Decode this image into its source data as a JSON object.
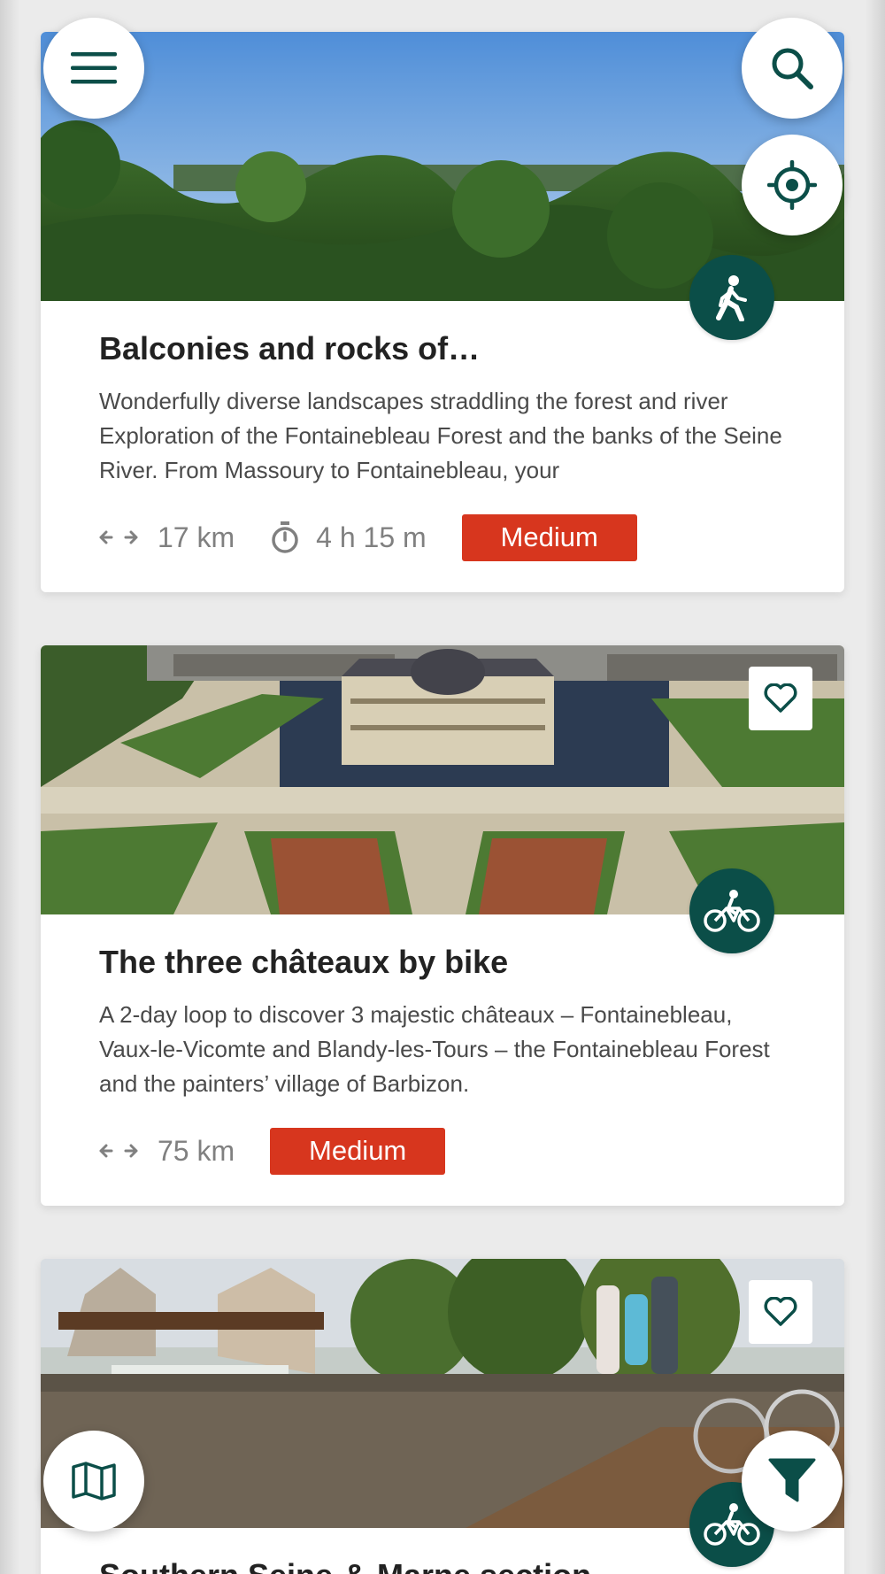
{
  "trails": [
    {
      "title": "Balconies and rocks of…",
      "description": "Wonderfully diverse landscapes straddling the forest and river Exploration of the Fontainebleau Forest and the banks of the Seine River. From Massoury to Fontainebleau, your",
      "distance": "17 km",
      "duration": "4 h 15 m",
      "difficulty": "Medium",
      "activity": "hiking-icon",
      "image": "forest panorama"
    },
    {
      "title": "The three châteaux by bike",
      "description": "A 2-day loop to discover 3 majestic châteaux – Fontainebleau, Vaux-le-Vicomte and Blandy-les-Tours – the Fontainebleau Forest and the painters’ village of Barbizon.",
      "distance": "75 km",
      "difficulty": "Medium",
      "activity": "bike-icon",
      "image": "château and gardens"
    },
    {
      "title": "Southern Seine-&-Marne section",
      "activity": "bike-icon",
      "image": "river with bikes"
    }
  ],
  "controls": {
    "menu": "menu-icon",
    "search": "search-icon",
    "locate": "locate-icon",
    "map": "map-icon",
    "filter": "filter-icon",
    "favorite": "heart-icon"
  },
  "colors": {
    "brand": "#0b4e48",
    "difficulty_medium": "#d7361e"
  }
}
